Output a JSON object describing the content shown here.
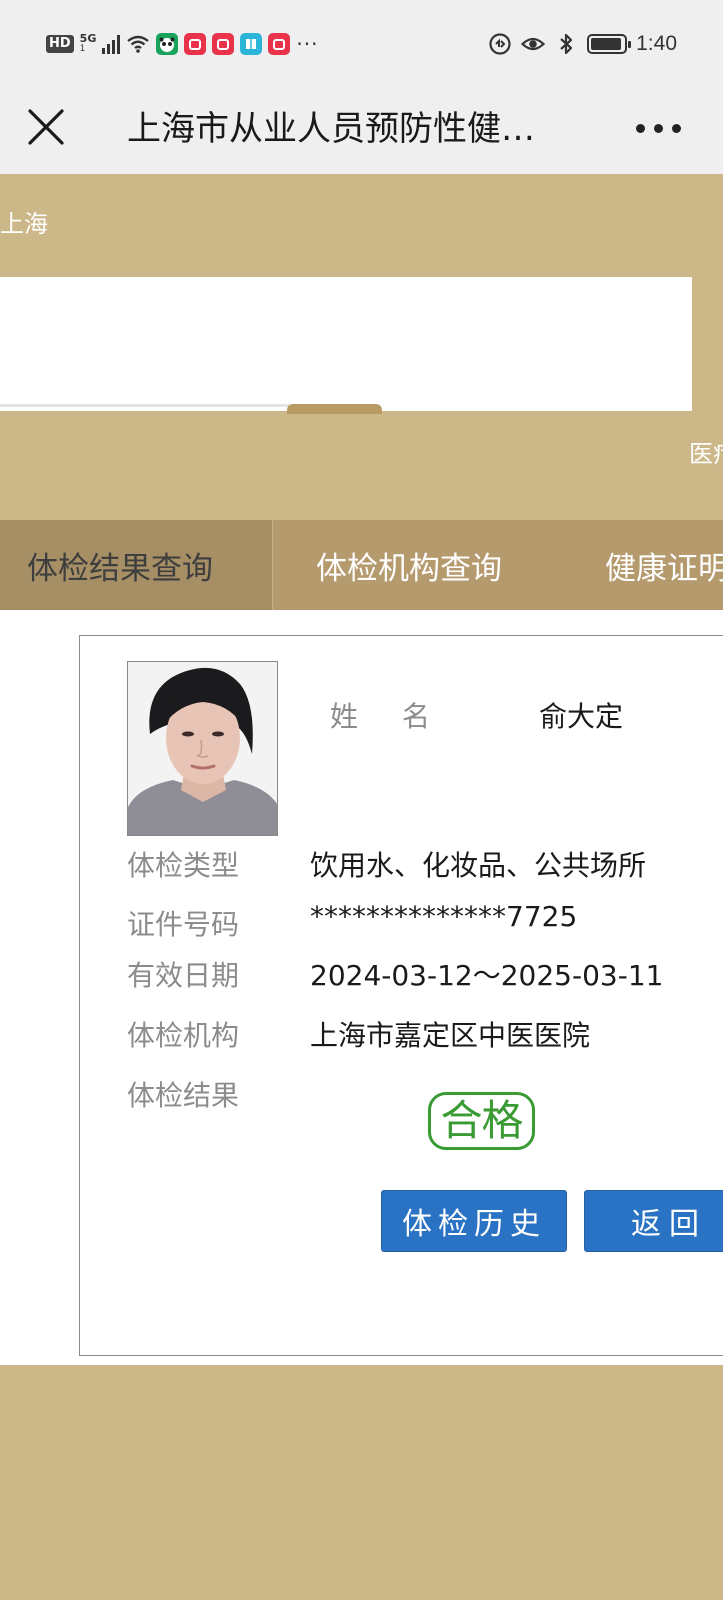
{
  "status_bar": {
    "hd": "HD",
    "network": "5G",
    "network_sub": "1",
    "more": "···",
    "time": "1:40"
  },
  "titlebar": {
    "title": "上海市从业人员预防性健…"
  },
  "header": {
    "region": "上海",
    "right_note": "医疗"
  },
  "tabs": [
    {
      "label": "体检结果查询"
    },
    {
      "label": "体检机构查询"
    },
    {
      "label": "健康证明"
    }
  ],
  "card": {
    "name_label": "姓名",
    "name_value": "俞大定",
    "rows": [
      {
        "label": "体检类型",
        "value": "饮用水、化妆品、公共场所"
      },
      {
        "label": "证件号码",
        "value": "**************7725"
      },
      {
        "label": "有效日期",
        "value": "2024-03-12～2025-03-11"
      },
      {
        "label": "体检机构",
        "value": "上海市嘉定区中医医院"
      },
      {
        "label": "体检结果",
        "value": ""
      }
    ],
    "result_stamp": "合格",
    "history_button": "体检历史",
    "back_button": "返回"
  }
}
